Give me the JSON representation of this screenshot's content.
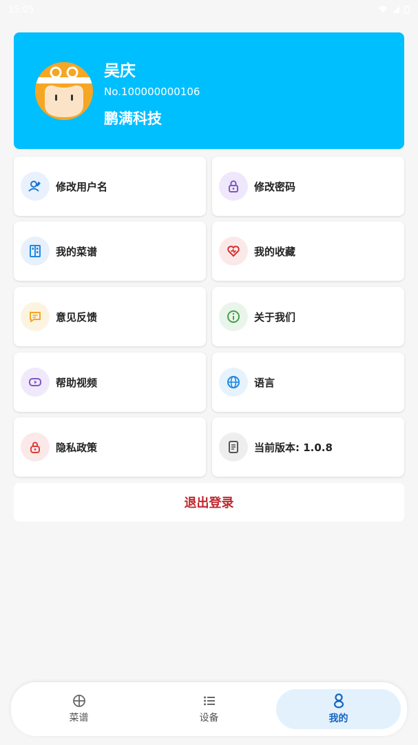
{
  "status_bar": {
    "time": "15:05"
  },
  "profile": {
    "name": "吴庆",
    "id": "No.100000000106",
    "company": "鹏满科技"
  },
  "menu": [
    {
      "label": "修改用户名",
      "icon": "user-edit-icon",
      "bg": "#e8f1fd",
      "color": "#1976d2"
    },
    {
      "label": "修改密码",
      "icon": "lock-icon",
      "bg": "#efe7fb",
      "color": "#7e57c2"
    },
    {
      "label": "我的菜谱",
      "icon": "recipe-book-icon",
      "bg": "#e7f0fb",
      "color": "#1e88e5"
    },
    {
      "label": "我的收藏",
      "icon": "heart-icon",
      "bg": "#fbe9ea",
      "color": "#d32f2f"
    },
    {
      "label": "意见反馈",
      "icon": "feedback-icon",
      "bg": "#fdf3e1",
      "color": "#f5a623"
    },
    {
      "label": "关于我们",
      "icon": "info-icon",
      "bg": "#e9f5ea",
      "color": "#43a047"
    },
    {
      "label": "帮助视频",
      "icon": "video-icon",
      "bg": "#f0e9fb",
      "color": "#7e57c2"
    },
    {
      "label": "语言",
      "icon": "globe-icon",
      "bg": "#e6f3fc",
      "color": "#1e88e5"
    },
    {
      "label": "隐私政策",
      "icon": "privacy-lock-icon",
      "bg": "#fbe9ea",
      "color": "#e53935"
    },
    {
      "label": "当前版本: 1.0.8",
      "icon": "document-icon",
      "bg": "#eeeeee",
      "color": "#555555"
    }
  ],
  "logout_label": "退出登录",
  "nav": [
    {
      "label": "菜谱",
      "icon": "crosshair-icon"
    },
    {
      "label": "设备",
      "icon": "list-icon"
    },
    {
      "label": "我的",
      "icon": "person-icon"
    }
  ]
}
